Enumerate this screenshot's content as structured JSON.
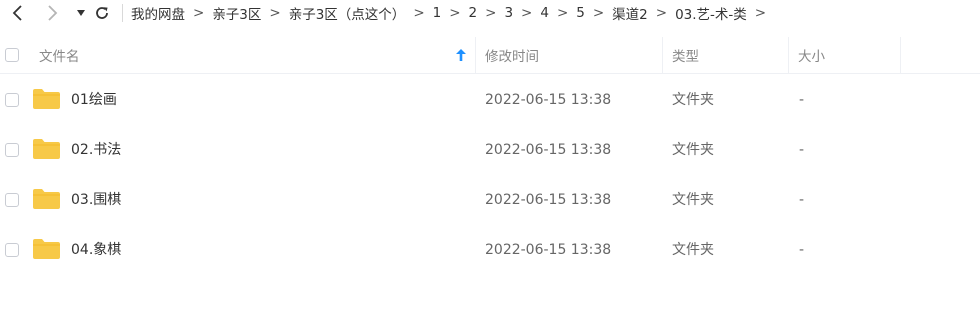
{
  "breadcrumb": [
    "我的网盘",
    "亲子3区",
    "亲子3区（点这个）",
    "1",
    "2",
    "3",
    "4",
    "5",
    "渠道2",
    "03.艺-术-类"
  ],
  "columns": {
    "name": "文件名",
    "modified": "修改时间",
    "type": "类型",
    "size": "大小"
  },
  "files": [
    {
      "name": "01绘画",
      "modified": "2022-06-15 13:38",
      "type": "文件夹",
      "size": "-"
    },
    {
      "name": "02.书法",
      "modified": "2022-06-15 13:38",
      "type": "文件夹",
      "size": "-"
    },
    {
      "name": "03.围棋",
      "modified": "2022-06-15 13:38",
      "type": "文件夹",
      "size": "-"
    },
    {
      "name": "04.象棋",
      "modified": "2022-06-15 13:38",
      "type": "文件夹",
      "size": "-"
    }
  ],
  "colors": {
    "folder": "#f7c948",
    "accent": "#1e90ff"
  },
  "icons": [
    "back-icon",
    "forward-icon",
    "dropdown-icon",
    "refresh-icon",
    "sort-up-icon",
    "folder-icon"
  ]
}
